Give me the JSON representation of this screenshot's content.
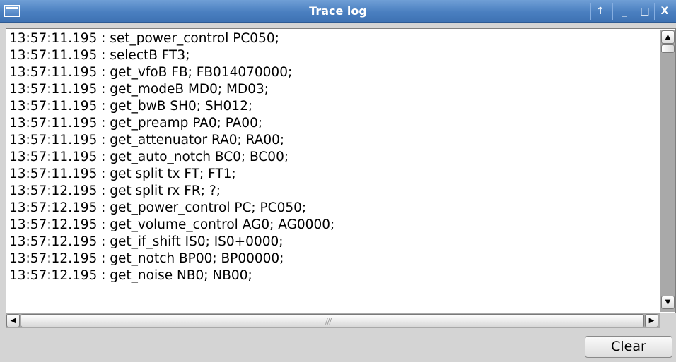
{
  "window": {
    "title": "Trace log",
    "controls": {
      "pin": "↑",
      "minimize": "_",
      "maximize": "□",
      "close": "X"
    }
  },
  "log": {
    "lines": [
      "13:57:11.195 : set_power_control PC050;",
      "13:57:11.195 : selectB FT3;",
      "13:57:11.195 : get_vfoB FB; FB014070000;",
      "13:57:11.195 : get_modeB MD0; MD03;",
      "13:57:11.195 : get_bwB SH0; SH012;",
      "13:57:11.195 : get_preamp PA0; PA00;",
      "13:57:11.195 : get_attenuator RA0; RA00;",
      "13:57:11.195 : get_auto_notch BC0; BC00;",
      "13:57:11.195 : get split tx FT; FT1;",
      "13:57:12.195 : get split rx FR; ?;",
      "13:57:12.195 : get_power_control PC; PC050;",
      "13:57:12.195 : get_volume_control AG0; AG0000;",
      "13:57:12.195 : get_if_shift IS0; IS0+0000;",
      "13:57:12.195 : get_notch BP00; BP00000;",
      "13:57:12.195 : get_noise NB0; NB00;"
    ]
  },
  "scrollbars": {
    "up_arrow": "▲",
    "down_arrow": "▼",
    "left_arrow": "◀",
    "right_arrow": "▶"
  },
  "actions": {
    "clear_label": "Clear"
  }
}
